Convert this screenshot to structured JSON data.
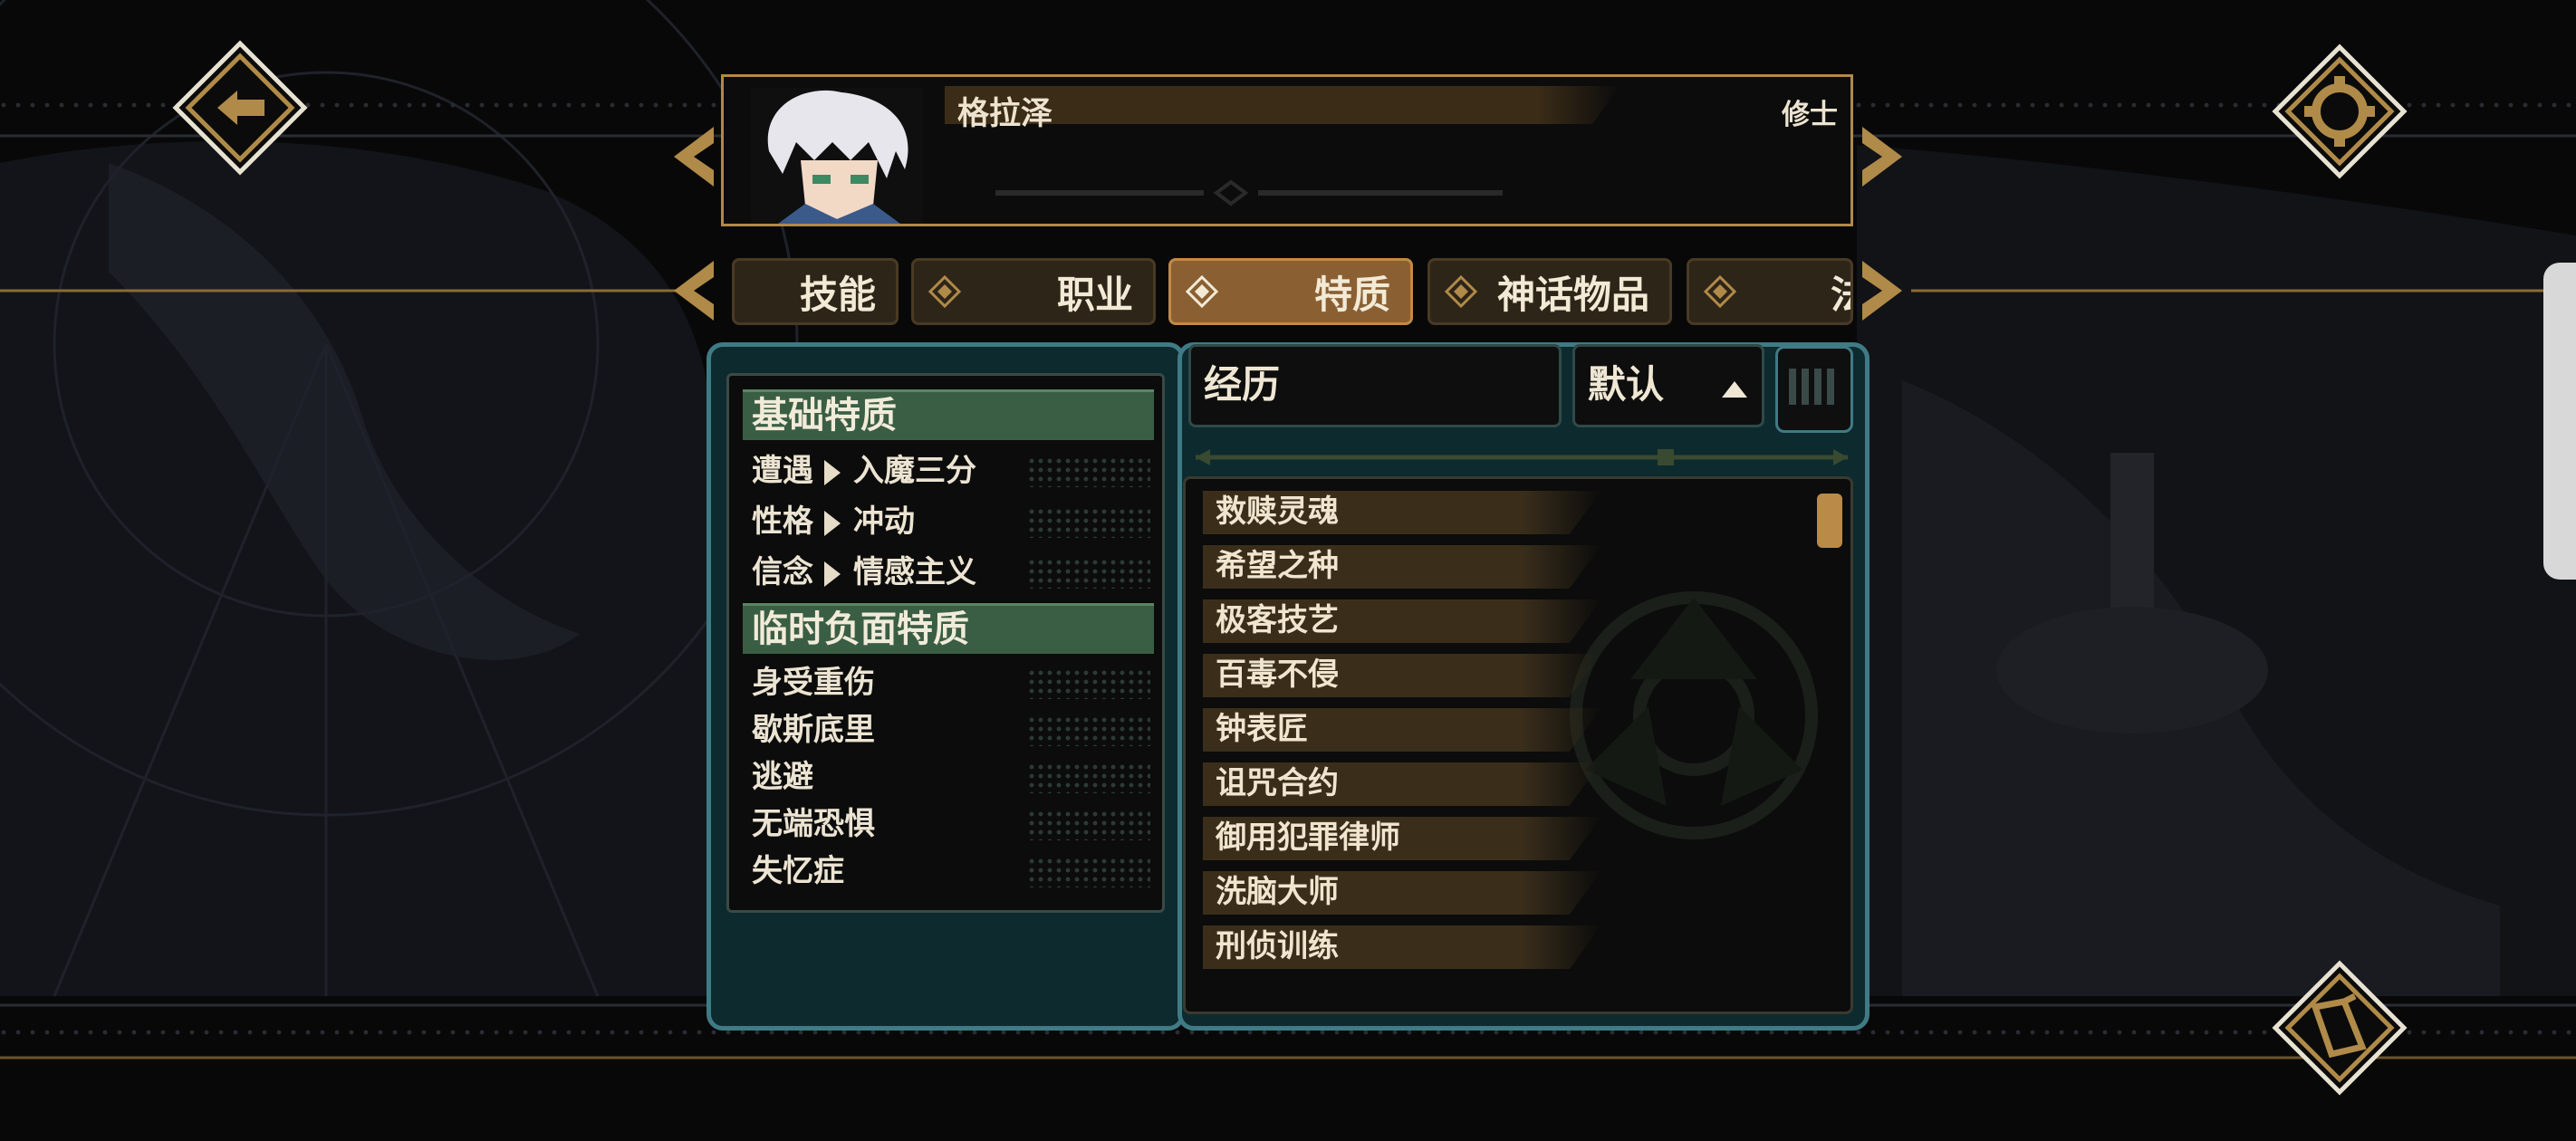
{
  "character": {
    "name": "格拉泽",
    "class": "修士"
  },
  "tabs": [
    {
      "label": "技能",
      "active": false
    },
    {
      "label": "职业",
      "active": false
    },
    {
      "label": "特质",
      "active": true
    },
    {
      "label": "神话物品",
      "active": false
    },
    {
      "label": "法",
      "active": false
    }
  ],
  "base_traits": {
    "header": "基础特质",
    "rows": [
      {
        "key": "遭遇",
        "value": "入魔三分"
      },
      {
        "key": "性格",
        "value": "冲动"
      },
      {
        "key": "信念",
        "value": "情感主义"
      }
    ]
  },
  "temp_traits": {
    "header": "临时负面特质",
    "rows": [
      "身受重伤",
      "歇斯底里",
      "逃避",
      "无端恐惧",
      "失忆症"
    ]
  },
  "sort": {
    "field": "经历",
    "direction": "默认"
  },
  "experiences": [
    "救赎灵魂",
    "希望之种",
    "极客技艺",
    "百毒不侵",
    "钟表匠",
    "诅咒合约",
    "御用犯罪律师",
    "洗脑大师",
    "刑侦训练"
  ],
  "icons": {
    "back": "back-arrow-icon",
    "settings": "gear-icon",
    "bottom_right": "journal-icon"
  },
  "colors": {
    "gold": "#b08a48",
    "teal_border": "#3f7b84",
    "active_tab": "#8a6033",
    "section_green": "#3a5e44"
  }
}
